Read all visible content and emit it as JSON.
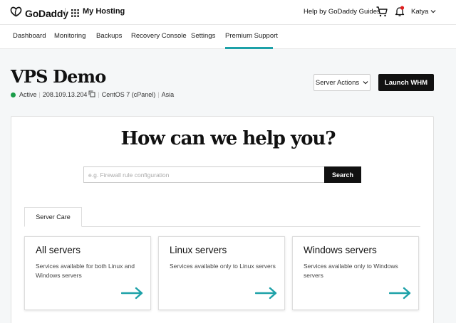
{
  "topbar": {
    "logo_text": "GoDaddy",
    "product_name": "My Hosting",
    "help_link": "Help by GoDaddy Guides",
    "user_name": "Katya"
  },
  "nav": {
    "items": [
      "Dashboard",
      "Monitoring",
      "Backups",
      "Recovery Console",
      "Settings",
      "Premium Support"
    ],
    "active": "Premium Support"
  },
  "server": {
    "name": "VPS Demo",
    "status": "Active",
    "ip": "208.109.13.204",
    "os": "CentOS 7 (cPanel)",
    "region": "Asia",
    "actions_label": "Server Actions",
    "launch_label": "Launch WHM"
  },
  "support": {
    "heading": "How can we help you?",
    "search_placeholder": "e.g. Firewall rule configuration",
    "search_button": "Search",
    "tab_label": "Server Care",
    "cards": [
      {
        "title": "All servers",
        "description": "Services available for both Linux and Windows servers"
      },
      {
        "title": "Linux servers",
        "description": "Services available only to Linux servers"
      },
      {
        "title": "Windows servers",
        "description": "Services available only to Windows servers"
      }
    ]
  },
  "colors": {
    "accent": "#1da1a8",
    "status_active": "#1a9c48",
    "notification": "#e01e1e",
    "primary_button": "#111111"
  }
}
